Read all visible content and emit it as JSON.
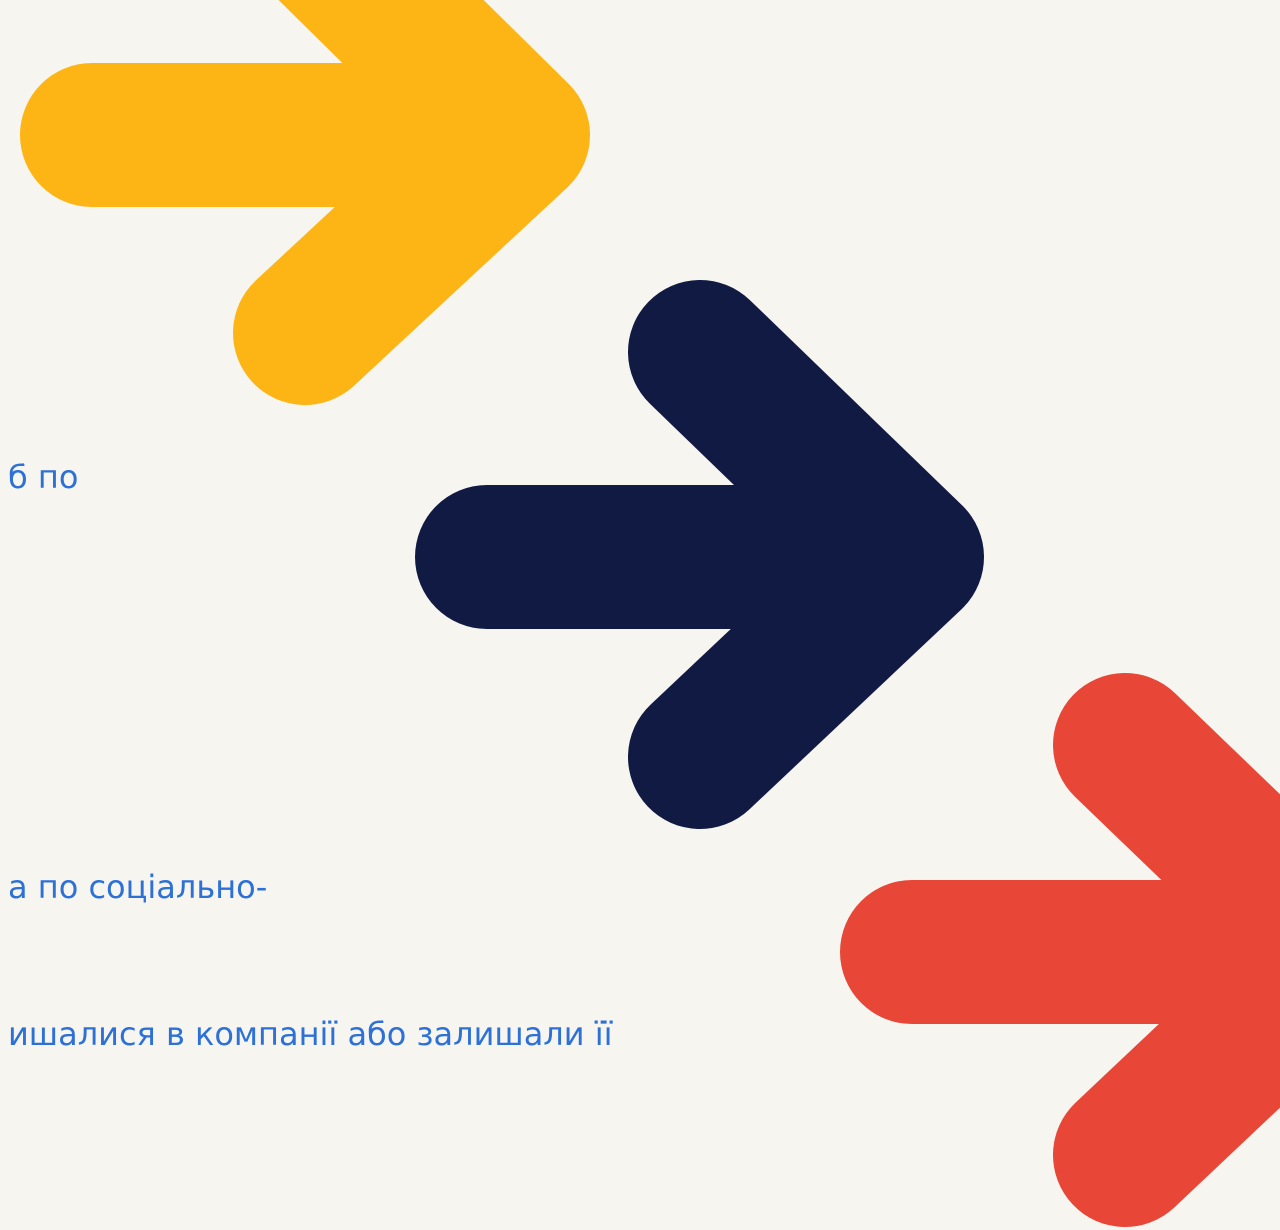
{
  "text_lines": [
    "б по",
    "а по соціально-",
    "ишалися в компанії або залишали її"
  ],
  "arrows": [
    {
      "name": "yellow-arrow",
      "color": "#FDB515"
    },
    {
      "name": "navy-arrow",
      "color": "#111A43"
    },
    {
      "name": "red-arrow",
      "color": "#E84637"
    }
  ],
  "colors": {
    "background": "#F6F5F0",
    "text": "#2D71D6"
  }
}
